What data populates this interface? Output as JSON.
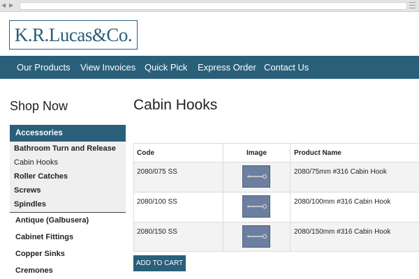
{
  "logo": {
    "text": "K.R.Lucas&Co."
  },
  "nav": {
    "items": [
      {
        "label": "Our Products"
      },
      {
        "label": "View Invoices"
      },
      {
        "label": "Quick Pick"
      },
      {
        "label": "Express Order"
      },
      {
        "label": "Contact Us"
      }
    ]
  },
  "sidebar": {
    "heading": "Shop Now",
    "active_category": "Accessories",
    "subcategories": [
      {
        "label": "Bathroom Turn and Release"
      },
      {
        "label": "Cabin Hooks"
      },
      {
        "label": "Roller Catches"
      },
      {
        "label": "Screws"
      },
      {
        "label": "Spindles"
      }
    ],
    "categories": [
      {
        "label": "Antique (Galbusera)"
      },
      {
        "label": "Cabinet Fittings"
      },
      {
        "label": "Copper Sinks"
      },
      {
        "label": "Cremones"
      }
    ]
  },
  "main": {
    "title": "Cabin Hooks",
    "table": {
      "headers": {
        "code": "Code",
        "image": "Image",
        "name": "Product Name"
      },
      "rows": [
        {
          "code": "2080/075 SS",
          "name": "2080/75mm #316 Cabin Hook"
        },
        {
          "code": "2080/100 SS",
          "name": "2080/100mm #316 Cabin Hook"
        },
        {
          "code": "2080/150 SS",
          "name": "2080/150mm #316 Cabin Hook"
        }
      ]
    },
    "add_to_cart_label": "ADD TO CART"
  },
  "colors": {
    "brand": "#2a5f7a",
    "thumb": "#6d7fa0"
  }
}
